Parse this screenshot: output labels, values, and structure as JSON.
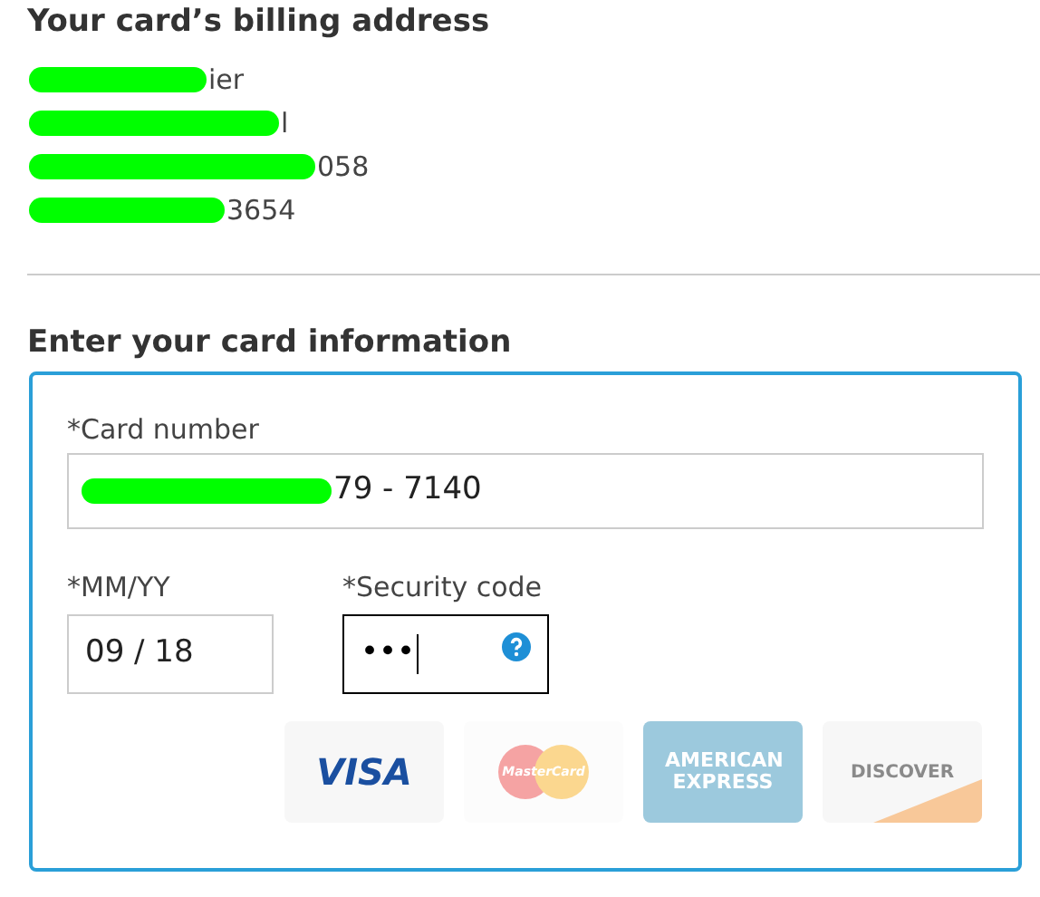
{
  "billing": {
    "title": "Your card’s billing address",
    "lines": [
      "ier",
      "l",
      "058",
      "3654"
    ]
  },
  "card_section": {
    "title": "Enter your card information",
    "card_number": {
      "label": "*Card number",
      "value": "79 - 7140"
    },
    "expiry": {
      "label": "*MM/YY",
      "value": "09 / 18"
    },
    "security_code": {
      "label": "*Security code",
      "value": "•••",
      "focused": true
    },
    "card_logos": [
      {
        "kind": "visa",
        "text": "VISA"
      },
      {
        "kind": "mastercard",
        "text": "MasterCard"
      },
      {
        "kind": "amex",
        "text": "AMERICAN EXPRESS"
      },
      {
        "kind": "discover",
        "text": "DISCOVER"
      }
    ]
  }
}
